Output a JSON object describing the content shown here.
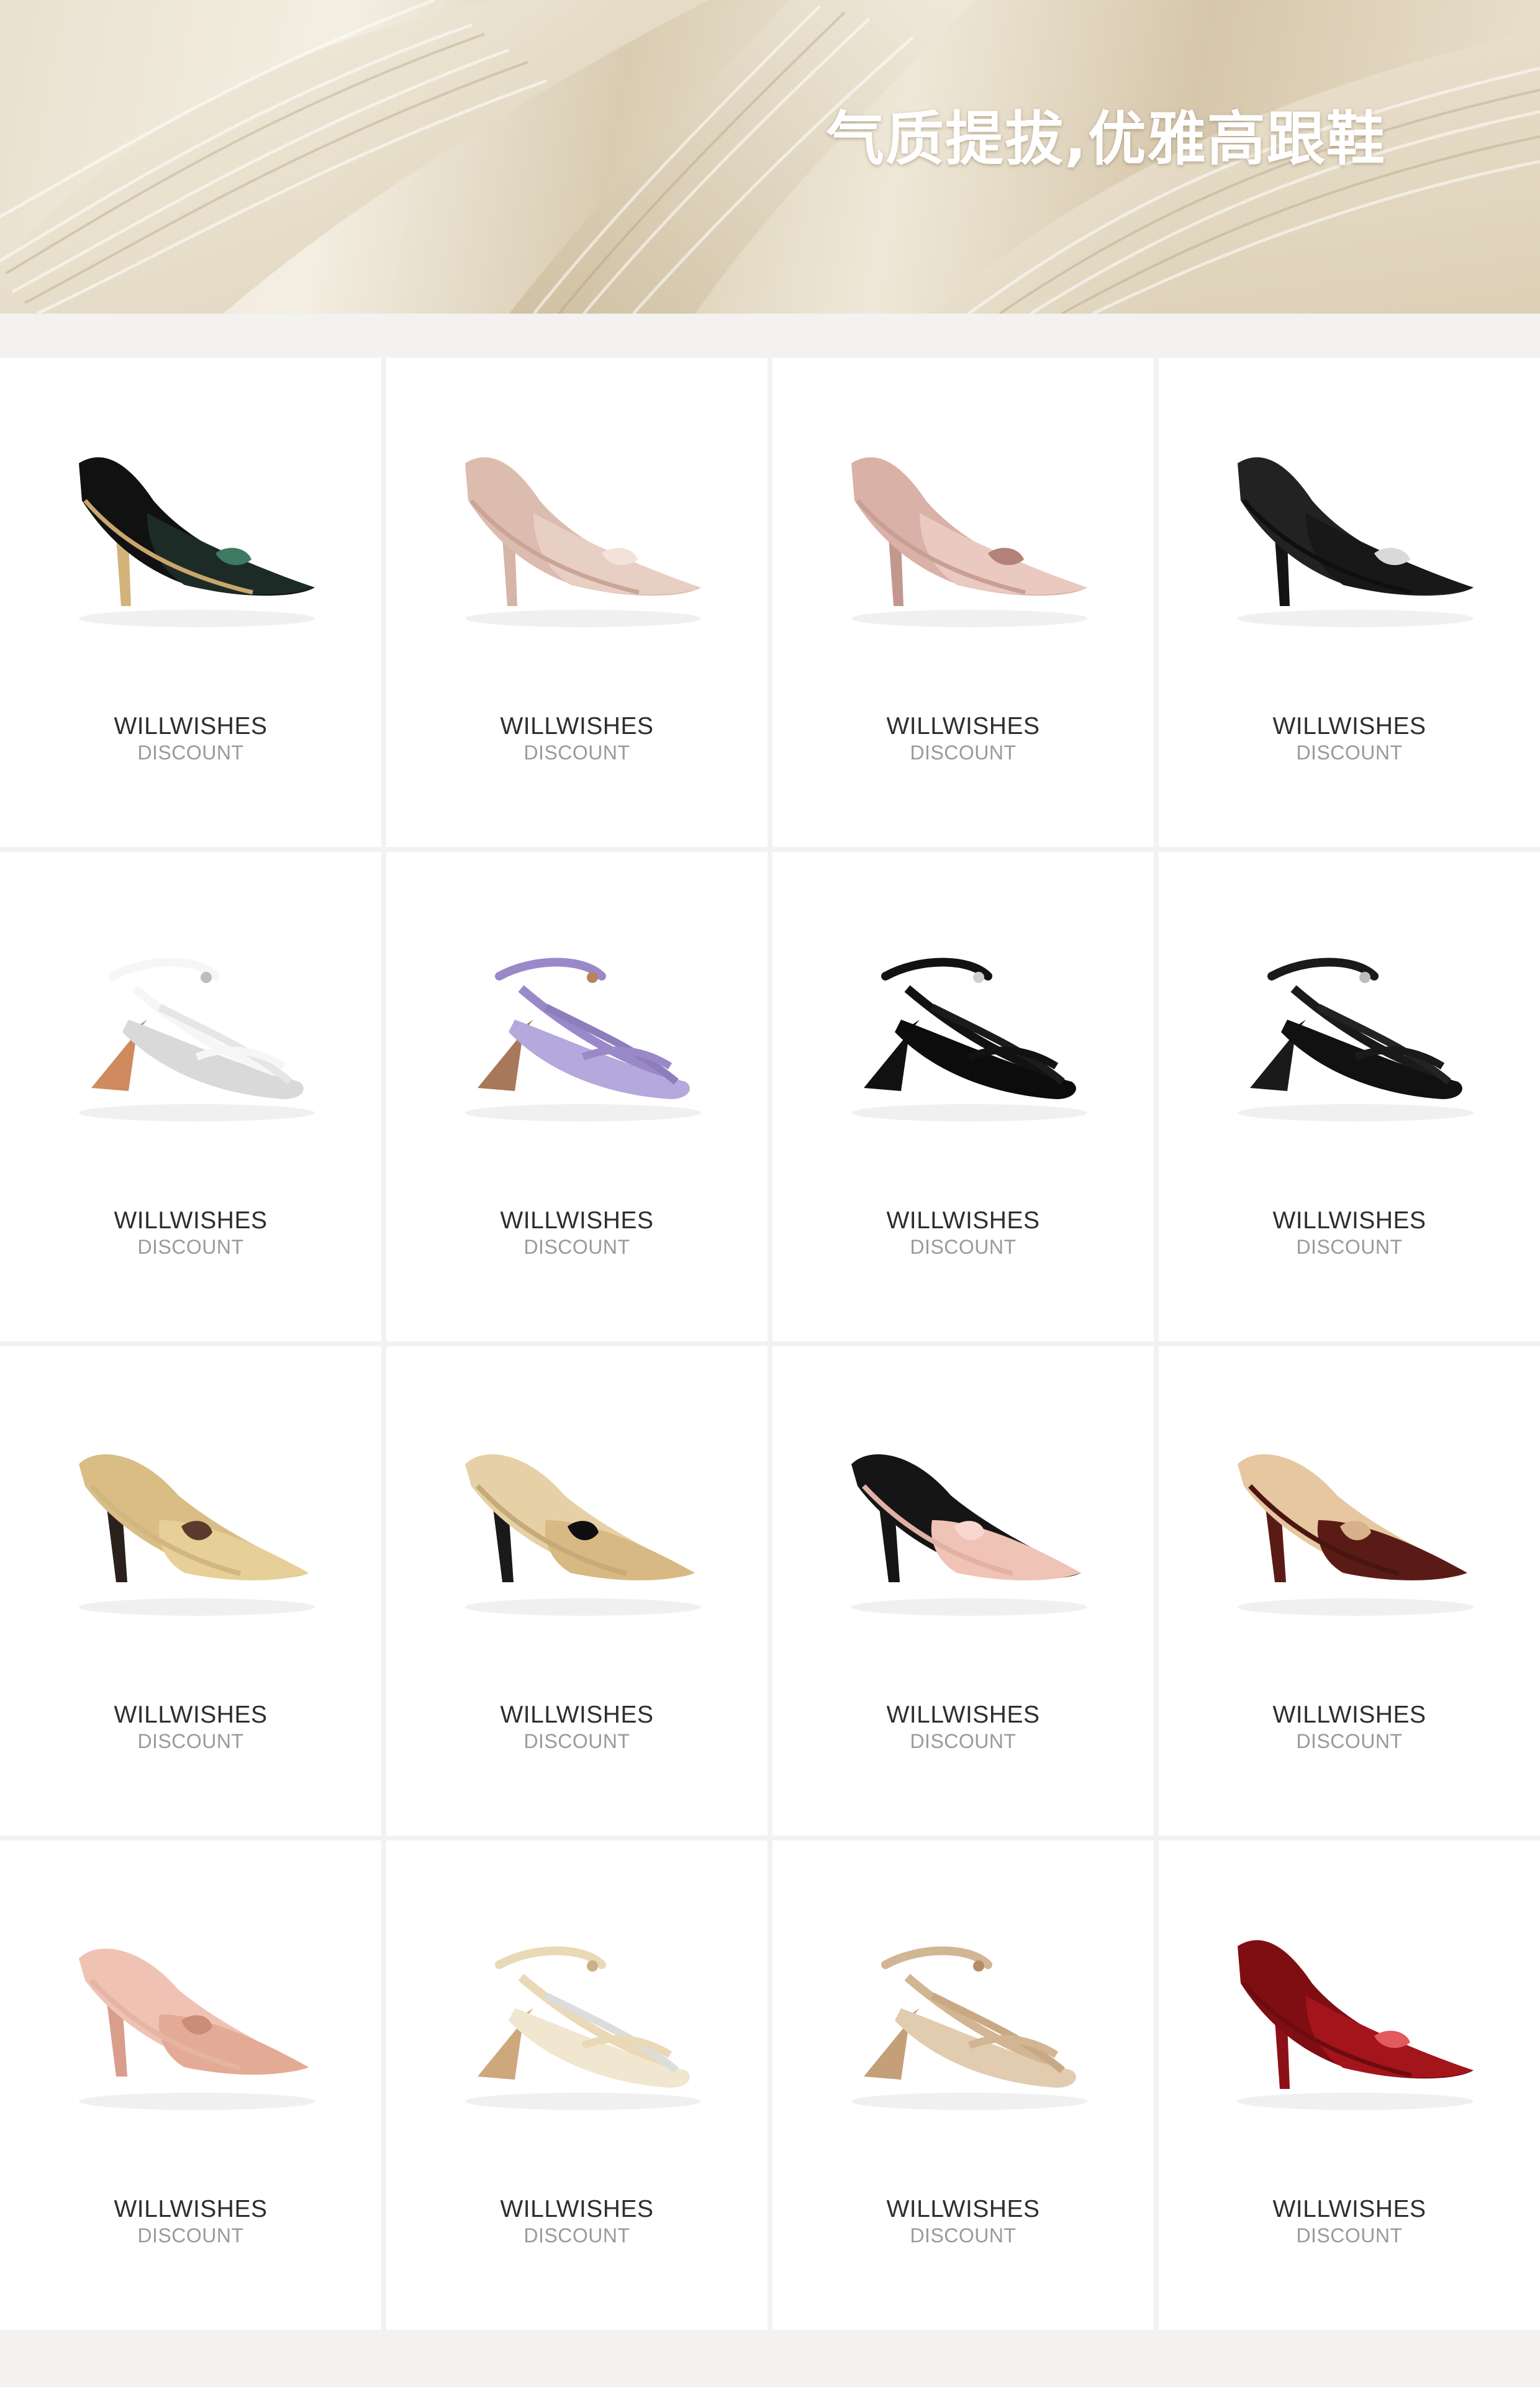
{
  "banner": {
    "title": "气质提拔,优雅高跟鞋"
  },
  "products": [
    {
      "brand": "WILLWISHES",
      "tag": "DISCOUNT",
      "icon": "black-green-sequin-pump-icon",
      "colors": {
        "upper": "#1d2b27",
        "back": "#111111",
        "sole": "#c9a66b",
        "heel": "#d3b37a",
        "accent": "#3f7a63"
      }
    },
    {
      "brand": "WILLWISHES",
      "tag": "DISCOUNT",
      "icon": "nude-floral-pump-icon",
      "colors": {
        "upper": "#e8cfc3",
        "back": "#dcbcaf",
        "sole": "#caa596",
        "heel": "#d6b4a6",
        "accent": "#f3e2da"
      }
    },
    {
      "brand": "WILLWISHES",
      "tag": "DISCOUNT",
      "icon": "pink-slingback-icon",
      "colors": {
        "upper": "#e9c9c0",
        "back": "#d9b1a6",
        "sole": "#c99f95",
        "heel": "#c2978d",
        "accent": "#b38278"
      }
    },
    {
      "brand": "WILLWISHES",
      "tag": "DISCOUNT",
      "icon": "black-crystal-buckle-slingback-icon",
      "colors": {
        "upper": "#181818",
        "back": "#222222",
        "sole": "#0f0f0f",
        "heel": "#141414",
        "accent": "#d9d9d9"
      }
    },
    {
      "brand": "WILLWISHES",
      "tag": "DISCOUNT",
      "icon": "white-strappy-sandal-icon",
      "colors": {
        "upper": "#f6f6f6",
        "back": "#e6e6e6",
        "sole": "#d9d9d9",
        "heel": "#cf8a5f",
        "accent": "#bdbdbd"
      }
    },
    {
      "brand": "WILLWISHES",
      "tag": "DISCOUNT",
      "icon": "lilac-thong-sandal-icon",
      "colors": {
        "upper": "#9a89c9",
        "back": "#8c7dbb",
        "sole": "#b4a8dd",
        "heel": "#a9775a",
        "accent": "#b7845f"
      }
    },
    {
      "brand": "WILLWISHES",
      "tag": "DISCOUNT",
      "icon": "black-bow-ankle-strap-sandal-icon",
      "colors": {
        "upper": "#121212",
        "back": "#1b1b1b",
        "sole": "#0c0c0c",
        "heel": "#111111",
        "accent": "#cfcfcf"
      }
    },
    {
      "brand": "WILLWISHES",
      "tag": "DISCOUNT",
      "icon": "black-t-strap-kitten-sandal-icon",
      "colors": {
        "upper": "#1a1a1a",
        "back": "#232323",
        "sole": "#111111",
        "heel": "#1a1a1a",
        "accent": "#bdbdbd"
      }
    },
    {
      "brand": "WILLWISHES",
      "tag": "DISCOUNT",
      "icon": "beige-brown-flower-mule-icon",
      "colors": {
        "upper": "#e7cf98",
        "back": "#d9bd84",
        "sole": "#d2b67f",
        "heel": "#2a211c",
        "accent": "#5a3b2d"
      }
    },
    {
      "brand": "WILLWISHES",
      "tag": "DISCOUNT",
      "icon": "beige-black-toe-bow-mule-icon",
      "colors": {
        "upper": "#d8b983",
        "back": "#e6d1a6",
        "sole": "#c8a978",
        "heel": "#1a1a1a",
        "accent": "#0f0f0f"
      }
    },
    {
      "brand": "WILLWISHES",
      "tag": "DISCOUNT",
      "icon": "pink-bow-mule-icon",
      "colors": {
        "upper": "#f0c3b7",
        "back": "#151515",
        "sole": "#e2b1a6",
        "heel": "#151515",
        "accent": "#f7d7cf"
      }
    },
    {
      "brand": "WILLWISHES",
      "tag": "DISCOUNT",
      "icon": "burgundy-eyelet-mule-icon",
      "colors": {
        "upper": "#5a1b16",
        "back": "#e6c7a0",
        "sole": "#4a1511",
        "heel": "#5a1b16",
        "accent": "#d7b18b"
      }
    },
    {
      "brand": "WILLWISHES",
      "tag": "DISCOUNT",
      "icon": "rose-gold-lace-mule-icon",
      "colors": {
        "upper": "#e3ab95",
        "back": "#efc2b3",
        "sole": "#e6b4a3",
        "heel": "#d99e8b",
        "accent": "#c98d78"
      }
    },
    {
      "brand": "WILLWISHES",
      "tag": "DISCOUNT",
      "icon": "gold-clear-strap-sandal-icon",
      "colors": {
        "upper": "#e9d9b6",
        "back": "#dcdcdc",
        "sole": "#f1e6cf",
        "heel": "#cda87d",
        "accent": "#c9b287"
      }
    },
    {
      "brand": "WILLWISHES",
      "tag": "DISCOUNT",
      "icon": "champagne-strappy-sandal-icon",
      "colors": {
        "upper": "#d2b592",
        "back": "#c9a984",
        "sole": "#e2ccb0",
        "heel": "#c49f78",
        "accent": "#b58e69"
      }
    },
    {
      "brand": "WILLWISHES",
      "tag": "DISCOUNT",
      "icon": "red-patent-slingback-icon",
      "colors": {
        "upper": "#a4151b",
        "back": "#7f0e13",
        "sole": "#6c0c10",
        "heel": "#8b1116",
        "accent": "#e05a5e"
      }
    }
  ]
}
